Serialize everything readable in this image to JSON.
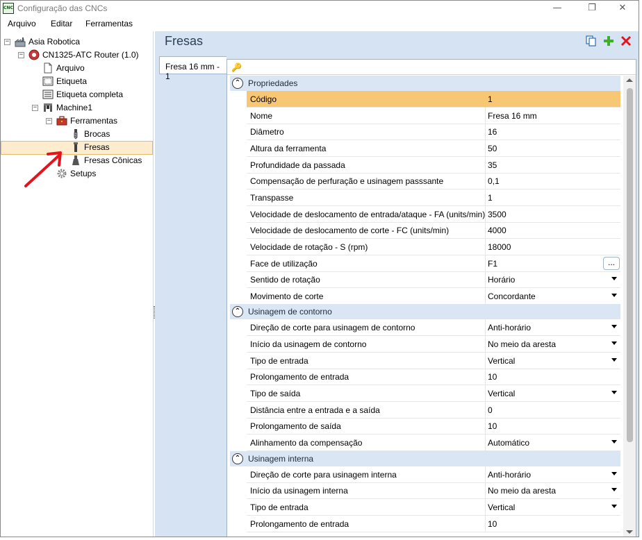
{
  "window": {
    "app_icon_text": "CNC",
    "title": "Configuração das CNCs",
    "controls": {
      "minimize": "—",
      "maximize": "❐",
      "close": "✕"
    }
  },
  "menu": {
    "items": [
      "Arquivo",
      "Editar",
      "Ferramentas"
    ]
  },
  "tree": {
    "root": "Asia Robotica",
    "cnc": "CN1325-ATC Router (1.0)",
    "arquivo": "Arquivo",
    "etiqueta": "Etiqueta",
    "etiqueta_completa": "Etiqueta completa",
    "machine": "Machine1",
    "ferramentas": "Ferramentas",
    "brocas": "Brocas",
    "fresas": "Fresas",
    "fresas_conicas": "Fresas Cônicas",
    "setups": "Setups"
  },
  "header": {
    "title": "Fresas"
  },
  "tabs": [
    "Fresa 16 mm - 1"
  ],
  "grid": {
    "search_icon": "key-icon",
    "categories": [
      "Propriedades",
      "Usinagem de contorno",
      "Usinagem interna"
    ],
    "propriedades": [
      {
        "name": "Código",
        "value": "1"
      },
      {
        "name": "Nome",
        "value": "Fresa 16 mm"
      },
      {
        "name": "Diâmetro",
        "value": "16"
      },
      {
        "name": "Altura da ferramenta",
        "value": "50"
      },
      {
        "name": "Profundidade da passada",
        "value": "35"
      },
      {
        "name": "Compensação de perfuração e usinagem passsante",
        "value": "0,1"
      },
      {
        "name": "Transpasse",
        "value": "1"
      },
      {
        "name": "Velocidade de deslocamento de entrada/ataque - FA (units/min)",
        "value": "3500"
      },
      {
        "name": "Velocidade de deslocamento de corte - FC (units/min)",
        "value": "4000"
      },
      {
        "name": "Velocidade de rotação - S (rpm)",
        "value": "18000"
      },
      {
        "name": "Face de utilização",
        "value": "F1"
      },
      {
        "name": "Sentido de rotação",
        "value": "Horário"
      },
      {
        "name": "Movimento de corte",
        "value": "Concordante"
      }
    ],
    "contorno": [
      {
        "name": "Direção de corte para usinagem de contorno",
        "value": "Anti-horário"
      },
      {
        "name": "Início da usinagem de contorno",
        "value": "No meio da aresta"
      },
      {
        "name": "Tipo de entrada",
        "value": "Vertical"
      },
      {
        "name": "Prolongamento de entrada",
        "value": "10"
      },
      {
        "name": "Tipo de saída",
        "value": "Vertical"
      },
      {
        "name": "Distância entre a entrada e a saída",
        "value": "0"
      },
      {
        "name": "Prolongamento de saída",
        "value": "10"
      },
      {
        "name": "Alinhamento da compensação",
        "value": "Automático"
      }
    ],
    "interna": [
      {
        "name": "Direção de corte para usinagem interna",
        "value": "Anti-horário"
      },
      {
        "name": "Início da usinagem interna",
        "value": "No meio da aresta"
      },
      {
        "name": "Tipo de entrada",
        "value": "Vertical"
      },
      {
        "name": "Prolongamento de entrada",
        "value": "10"
      }
    ],
    "ellipsis": "..."
  },
  "colors": {
    "accent": "#d6e3f3",
    "highlight": "#f7c773",
    "arrow": "#e3141b"
  }
}
